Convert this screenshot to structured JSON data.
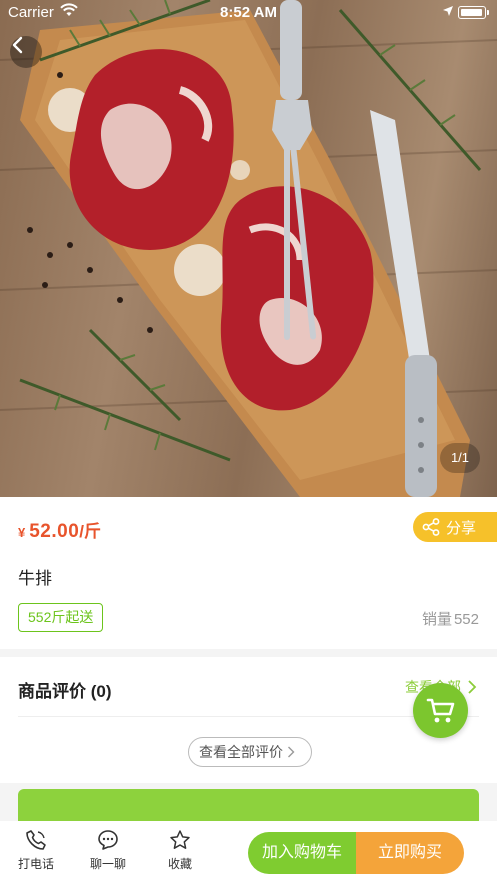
{
  "status_bar": {
    "carrier": "Carrier",
    "time": "8:52 AM"
  },
  "gallery": {
    "pager": "1/1",
    "image_alt": "牛排"
  },
  "product": {
    "price_symbol": "¥",
    "price": "52.00",
    "price_unit": "/斤",
    "share_label": "分享",
    "name": "牛排",
    "min_order": "552斤起送",
    "sales_label": "销量",
    "sales_count": "552"
  },
  "reviews": {
    "title": "商品评价 (0)",
    "see_all_label": "查看全部",
    "view_all_button": "查看全部评价"
  },
  "bottom_bar": {
    "call_label": "打电话",
    "chat_label": "聊一聊",
    "favorite_label": "收藏",
    "add_to_cart_label": "加入购物车",
    "buy_now_label": "立即购买"
  },
  "colors": {
    "accent_green": "#7cc62e",
    "price_red": "#e8542c",
    "share_yellow": "#f6c12a",
    "buy_orange": "#f4a43a"
  }
}
